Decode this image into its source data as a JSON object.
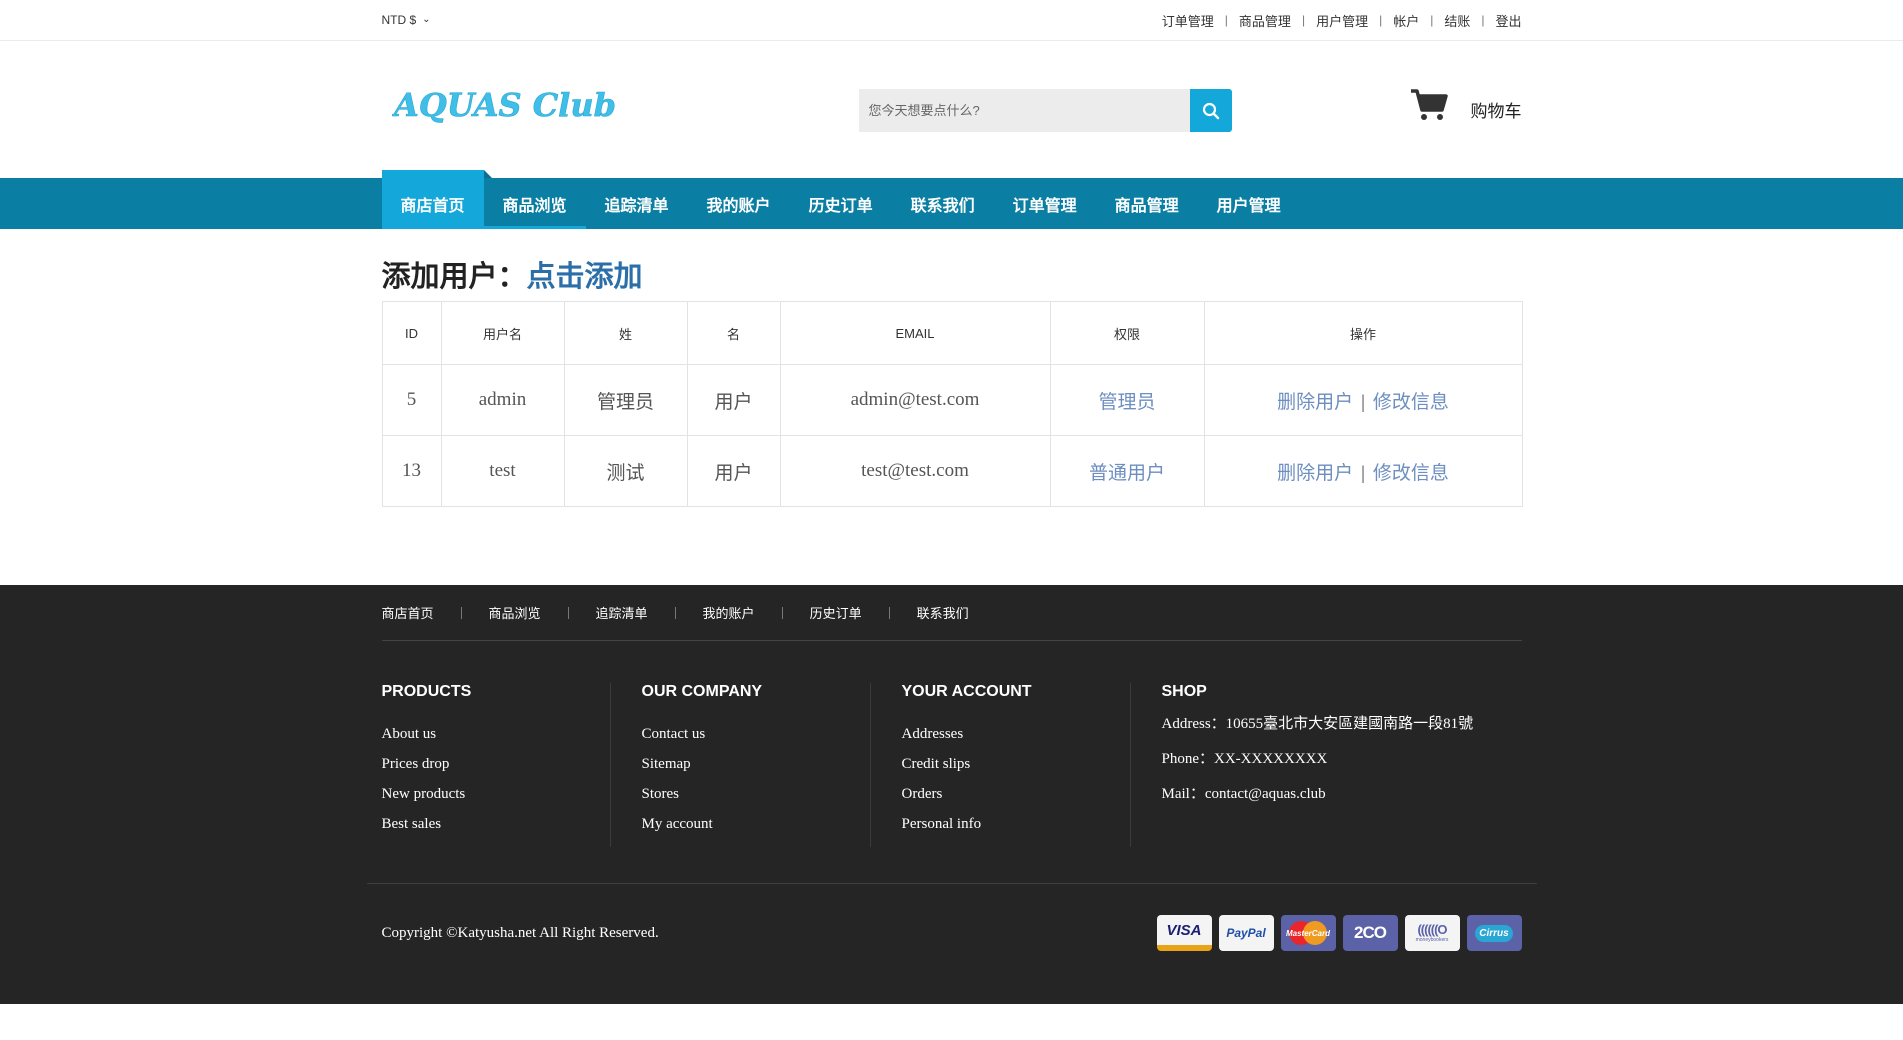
{
  "topbar": {
    "currency": "NTD $",
    "links": [
      "订单管理",
      "商品管理",
      "用户管理",
      "帐户",
      "结账",
      "登出"
    ]
  },
  "header": {
    "logo_text": "AQUAS Club",
    "search_placeholder": "您今天想要点什么?",
    "cart_label": "购物车"
  },
  "nav": {
    "items": [
      "商店首页",
      "商品浏览",
      "追踪清单",
      "我的账户",
      "历史订单",
      "联系我们",
      "订单管理",
      "商品管理",
      "用户管理"
    ]
  },
  "main": {
    "title_prefix": "添加用户：",
    "title_link": "点击添加",
    "table": {
      "headers": [
        "ID",
        "用户名",
        "姓",
        "名",
        "EMAIL",
        "权限",
        "操作"
      ],
      "rows": [
        {
          "id": "5",
          "username": "admin",
          "last": "管理员",
          "first": "用户",
          "email": "admin@test.com",
          "perm": "管理员",
          "delete": "删除用户",
          "edit": "修改信息"
        },
        {
          "id": "13",
          "username": "test",
          "last": "测试",
          "first": "用户",
          "email": "test@test.com",
          "perm": "普通用户",
          "delete": "删除用户",
          "edit": "修改信息"
        }
      ]
    }
  },
  "footer": {
    "nav": [
      "商店首页",
      "商品浏览",
      "追踪清单",
      "我的账户",
      "历史订单",
      "联系我们"
    ],
    "cols": [
      {
        "title": "PRODUCTS",
        "links": [
          "About us",
          "Prices drop",
          "New products",
          "Best sales"
        ]
      },
      {
        "title": "OUR COMPANY",
        "links": [
          "Contact us",
          "Sitemap",
          "Stores",
          "My account"
        ]
      },
      {
        "title": "YOUR ACCOUNT",
        "links": [
          "Addresses",
          "Credit slips",
          "Orders",
          "Personal info"
        ]
      }
    ],
    "shop": {
      "title": "SHOP",
      "address": "Address：10655臺北市大安區建國南路一段81號",
      "phone": "Phone：XX-XXXXXXXX",
      "mail": "Mail：contact@aquas.club"
    },
    "copyright": "Copyright ©Katyusha.net All Right Reserved.",
    "payments": [
      "VISA",
      "PayPal",
      "MasterCard",
      "2CO",
      "moneybookers",
      "Cirrus"
    ]
  },
  "colors": {
    "nav_bg": "#0b7ea3",
    "nav_active": "#14a7d9",
    "link_blue": "#2b6ea8",
    "footer_bg": "#252525",
    "logo": "#3fbfe8"
  }
}
